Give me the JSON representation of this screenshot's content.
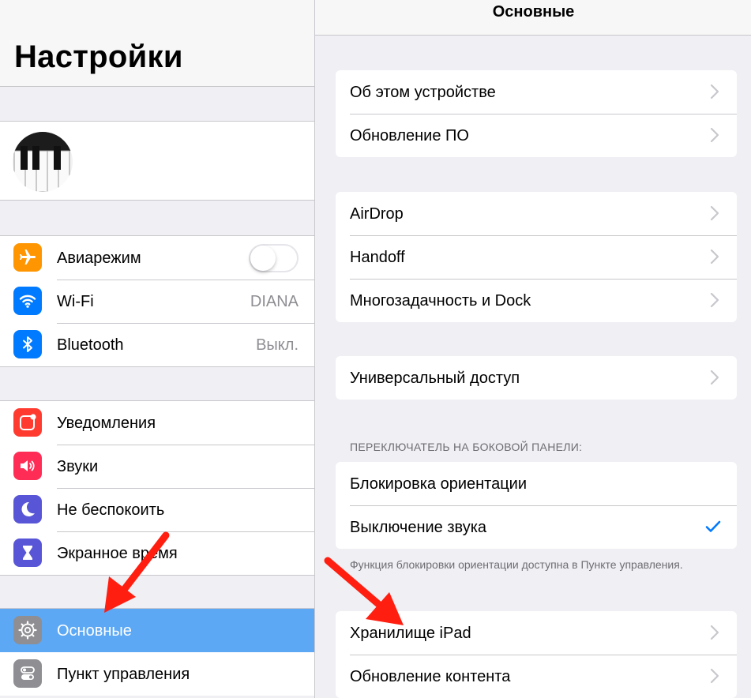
{
  "left": {
    "title": "Настройки",
    "profile": {
      "name": "",
      "subtitle": ""
    },
    "groups": [
      {
        "items": [
          {
            "label": "Авиарежим",
            "icon": "airplane-icon",
            "color": "#ff9500",
            "toggle": false
          },
          {
            "label": "Wi-Fi",
            "icon": "wifi-icon",
            "color": "#007aff",
            "value": "DIANA"
          },
          {
            "label": "Bluetooth",
            "icon": "bluetooth-icon",
            "color": "#007aff",
            "value": "Выкл."
          }
        ]
      },
      {
        "items": [
          {
            "label": "Уведомления",
            "icon": "notifications-icon",
            "color": "#ff3b30"
          },
          {
            "label": "Звуки",
            "icon": "sounds-icon",
            "color": "#ff2d55"
          },
          {
            "label": "Не беспокоить",
            "icon": "moon-icon",
            "color": "#5856d6"
          },
          {
            "label": "Экранное время",
            "icon": "hourglass-icon",
            "color": "#5856d6"
          }
        ]
      },
      {
        "items": [
          {
            "label": "Основные",
            "icon": "gear-icon",
            "color": "#8e8e93",
            "selected": true
          },
          {
            "label": "Пункт управления",
            "icon": "control-center-icon",
            "color": "#8e8e93"
          }
        ]
      }
    ]
  },
  "right": {
    "title": "Основные",
    "cards": [
      {
        "rows": [
          "Об этом устройстве",
          "Обновление ПО"
        ]
      },
      {
        "rows": [
          "AirDrop",
          "Handoff",
          "Многозадачность и Dock"
        ]
      },
      {
        "rows": [
          "Универсальный доступ"
        ]
      },
      {
        "rows": [
          "Блокировка ориентации",
          "Выключение звука"
        ]
      },
      {
        "rows": [
          "Хранилище iPad",
          "Обновление контента"
        ]
      }
    ],
    "section_header": "ПЕРЕКЛЮЧАТЕЛЬ НА БОКОВОЙ ПАНЕЛИ:",
    "section_footer": "Функция блокировки ориентации доступна в Пункте управления.",
    "checked_row": "Выключение звука"
  },
  "colors": {
    "selected_row": "#5ca8f5",
    "arrow": "#ff1e10",
    "checkmark": "#007aff"
  }
}
